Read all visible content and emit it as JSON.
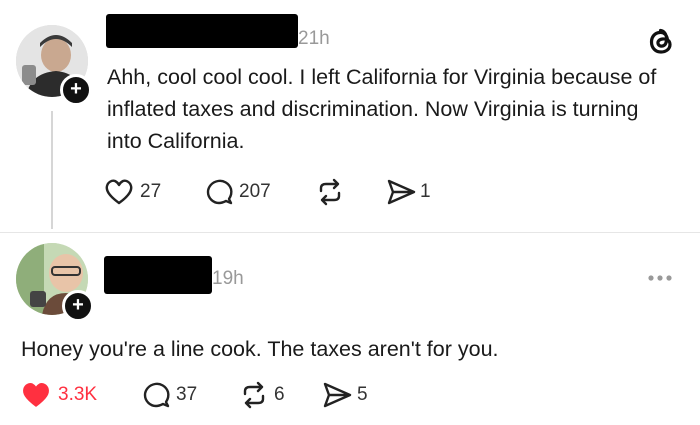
{
  "posts": [
    {
      "time": "21h",
      "text": "Ahh, cool cool cool. I left California for Virginia because of inflated taxes and discrimination. Now Virginia is turning into California.",
      "likes": "27",
      "replies": "207",
      "shares": "1",
      "reposts": ""
    },
    {
      "time": "19h",
      "text": "Honey you're a line cook. The taxes aren't for you.",
      "likes": "3.3K",
      "replies": "37",
      "reposts": "6",
      "shares": "5"
    }
  ],
  "icons": {
    "app": "threads-logo-icon",
    "follow": "plus-icon",
    "like": "heart-icon",
    "reply": "comment-icon",
    "repost": "repost-icon",
    "share": "send-icon",
    "more": "more-icon"
  },
  "colors": {
    "liked": "#ff3040",
    "muted": "#999999"
  },
  "follow_glyph": "+"
}
